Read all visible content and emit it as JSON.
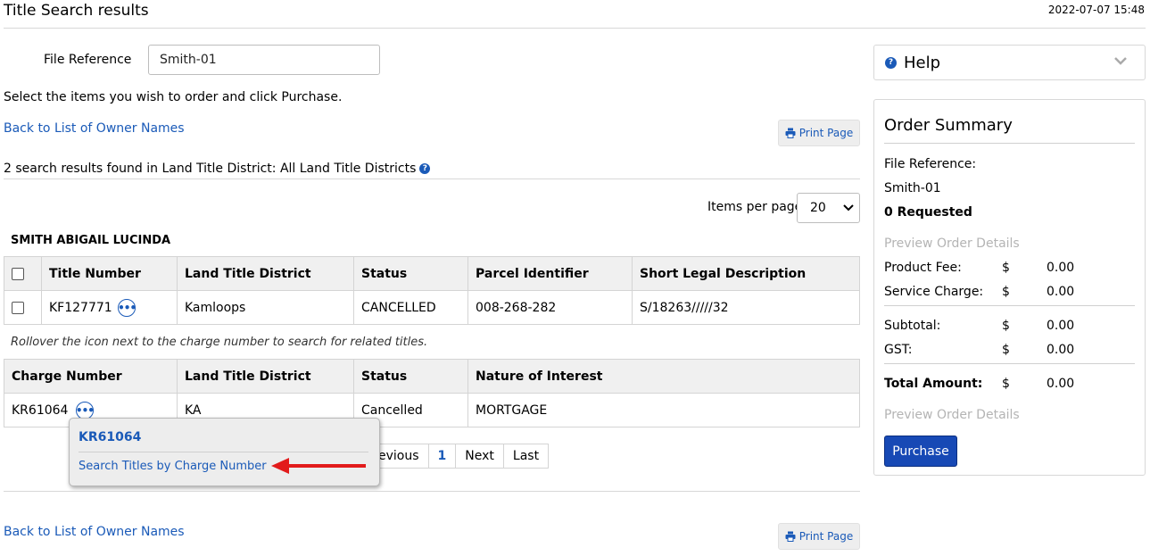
{
  "header": {
    "title": "Title Search results",
    "timestamp": "2022-07-07 15:48"
  },
  "file_reference": {
    "label": "File Reference",
    "value": "Smith-01"
  },
  "instruction": "Select the items you wish to order and click Purchase.",
  "back_link": "Back to List of Owner Names",
  "print_label": "Print Page",
  "results_summary": "2 search results found in Land Title District: All Land Title Districts",
  "items_per_page": {
    "label": "Items per page",
    "value": "20"
  },
  "owner_name": "SMITH ABIGAIL LUCINDA",
  "titles_table": {
    "headers": [
      "Title Number",
      "Land Title District",
      "Status",
      "Parcel Identifier",
      "Short Legal Description"
    ],
    "rows": [
      {
        "title_number": "KF127771",
        "district": "Kamloops",
        "status": "CANCELLED",
        "pid": "008-268-282",
        "legal": "S/18263/////32"
      }
    ]
  },
  "rollover_note": "Rollover the icon next to the charge number to search for related titles.",
  "charges_table": {
    "headers": [
      "Charge Number",
      "Land Title District",
      "Status",
      "Nature of Interest"
    ],
    "rows": [
      {
        "charge_number": "KR61064",
        "district": "KA",
        "status": "Cancelled",
        "nature": "MORTGAGE"
      }
    ]
  },
  "pagination": {
    "previous": "evious",
    "current": "1",
    "next": "Next",
    "last": "Last"
  },
  "popup": {
    "title": "KR61064",
    "link": "Search Titles by Charge Number",
    "arrow_color": "#e21b1b"
  },
  "help": {
    "label": "Help"
  },
  "order_summary": {
    "title": "Order Summary",
    "file_ref_label": "File Reference:",
    "file_ref_value": "Smith-01",
    "requested": "0 Requested",
    "preview": "Preview Order Details",
    "product_fee": {
      "label": "Product Fee:",
      "currency": "$",
      "amount": "0.00"
    },
    "service_charge": {
      "label": "Service Charge:",
      "currency": "$",
      "amount": "0.00"
    },
    "subtotal": {
      "label": "Subtotal:",
      "currency": "$",
      "amount": "0.00"
    },
    "gst": {
      "label": "GST:",
      "currency": "$",
      "amount": "0.00"
    },
    "total": {
      "label": "Total Amount:",
      "currency": "$",
      "amount": "0.00"
    },
    "purchase_label": "Purchase"
  },
  "colors": {
    "link": "#1a5ab8",
    "purchase_button": "#1749b5",
    "table_header_bg": "#f0f0f0"
  }
}
